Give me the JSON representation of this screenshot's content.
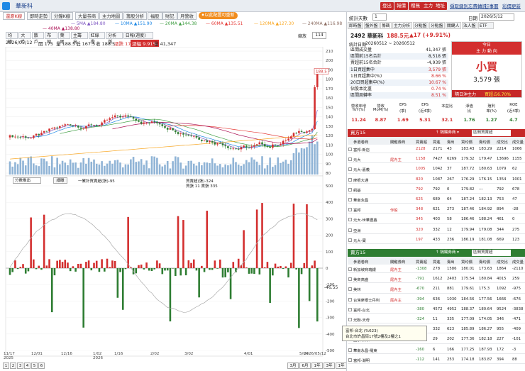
{
  "window": {
    "title": "華新科"
  },
  "top_buttons": [
    "登出",
    "報價",
    "贈無",
    "主力",
    "地址"
  ],
  "top_links": [
    "擷取鍵別",
    "忘費轉訊",
    "行事曆",
    "彩價更新"
  ],
  "tabs": [
    "還原K線",
    "即時走勢",
    "分鐘K線",
    "大量劵商",
    "主力地圖",
    "籌股分析",
    "福股",
    "財記",
    "月營收"
  ],
  "tab_chip": "⚫以此配置可重新",
  "ma_legend": [
    {
      "label": "5MA ▲184.80",
      "color": "#7e57c2"
    },
    {
      "label": "10MA ▲151.90",
      "color": "#1e88e5"
    },
    {
      "label": "20MA ▲144.38",
      "color": "#43a047"
    },
    {
      "label": "60MA ▲135.51",
      "color": "#e53935"
    },
    {
      "label": "120MA ▲127.30",
      "color": "#f9a825"
    },
    {
      "label": "240MA ▲116.98",
      "color": "#8d6e63"
    }
  ],
  "ma_legend2": "40MA ▲138.80",
  "toolbar": [
    "均線",
    "大戶",
    "散戶",
    "布林",
    "葉尾",
    "主籌出",
    "紅綠燈",
    "分析版",
    "日報(週度)"
  ],
  "price_info": {
    "date": "2026/05/12",
    "open": "開 175",
    "high": "量 188.5",
    "low": "低 167.5",
    "close": "收 188.5",
    "chg": "漲跌 17",
    "pct": "漲幅 9.91%",
    "vol": "量 41,347"
  },
  "zoom": "114",
  "zoom_btn": "縮放",
  "price_tag": "188.5",
  "price_axis": [
    "210",
    "200",
    "190",
    "180",
    "170",
    "160",
    "150",
    "140",
    "130",
    "120",
    "110",
    "100",
    "90",
    "80"
  ],
  "lower_axis": [
    "500",
    "400",
    "300",
    "200",
    "100",
    "0",
    "-100",
    "-200",
    "-300",
    "-400",
    "-500"
  ],
  "lower_tag": "-46.55",
  "lower_controls": {
    "select": "分數推出",
    "button": "細瞰",
    "legend1": "一累計買賣超(張)-95",
    "legend2": "買賣超(張)-324",
    "legend3": "買張 11 賣張 335"
  },
  "x_labels": [
    {
      "t": "11/17\n2025"
    },
    {
      "t": "12/01"
    },
    {
      "t": "12/16"
    },
    {
      "t": "1/02\n2026"
    },
    {
      "t": "1/16"
    },
    {
      "t": "2/02"
    },
    {
      "t": "3/02"
    },
    {
      "t": "4/01"
    },
    {
      "t": "5/04"
    },
    {
      "t": "2026/05/12"
    }
  ],
  "pager": [
    "1",
    "2",
    "3",
    "4",
    "5",
    "6"
  ],
  "period_btns": [
    "3月",
    "6月",
    "1年",
    "3年",
    "1年"
  ],
  "right": {
    "period_label": "統計天數",
    "period_value": "1",
    "date_label": "日期",
    "date_value": "2026/5/12",
    "nav_tabs": [
      "即時盤",
      "盤外盤",
      "籌碼",
      "主力分析",
      "分點盤",
      "分點盤",
      "關鍵人",
      "法人盤",
      "ETF"
    ],
    "stock": "2492 華新科",
    "price": "188.5元",
    "change": "▲17 (+9.91%)",
    "stat_label": "統計日期",
    "stat_range": "20260512 ~ 20260512",
    "today": "今日",
    "today_sub": "主 力 動 向",
    "stats": [
      {
        "k": "區間成交量",
        "v": "41,347 張"
      },
      {
        "k": "區間前15名合計",
        "v": "8,518 張"
      },
      {
        "k": "賣超前15名合計",
        "v": "-4,939 張"
      },
      {
        "k": "1日買超集中",
        "v": "3,579 張"
      },
      {
        "k": "1日買超集中(%)",
        "v": "8.66 %"
      },
      {
        "k": "20日買超集中(%)",
        "v": "10.67 %"
      },
      {
        "k": "佔股本比重",
        "v": "0.74 %"
      },
      {
        "k": "區間周轉率",
        "v": "8.51 %"
      }
    ],
    "big_label": "小買",
    "big_value": "3,579 張",
    "footer_l": "隔日沖主力",
    "footer_r": "買超占6.70%",
    "metrics_hdr": [
      "營收年增\nYoY(%)",
      "營收\nMoM(%)",
      "EPS\n(季)",
      "EPS\n(近4季)",
      "本益比",
      "淨值\n比",
      "殖利\n率(%)",
      "ROE\n(近4季)"
    ],
    "metrics": [
      "11.24",
      "8.87",
      "1.69",
      "5.31",
      "32.1",
      "1.76",
      "1.27",
      "4.7"
    ],
    "buy_title": "買方15",
    "sell_title": "賣方15",
    "buy_subtitle": "↑ 隔鍵券商 ▾",
    "buy_dropdown": "區間買賣超",
    "cols": [
      "參選卷商",
      "關鍵券商",
      "買賣超",
      "買進",
      "賣出",
      "買均價",
      "賣均價",
      "成交比",
      "成交量"
    ],
    "buy_rows": [
      [
        "富邦-新店",
        "",
        "2128",
        "2171",
        "43",
        "183.43",
        "183.29",
        "2214",
        "1066"
      ],
      [
        "元大",
        "尾內主",
        "1158",
        "7427",
        "6269",
        "179.32",
        "179.47",
        "13696",
        "1155"
      ],
      [
        "元大-嘉義",
        "",
        "1005",
        "1042",
        "37",
        "187.72",
        "180.63",
        "1079",
        "62"
      ],
      [
        "摩根大通",
        "",
        "820",
        "1087",
        "267",
        "176.29",
        "176.15",
        "1354",
        "1001"
      ],
      [
        "凱基",
        "",
        "792",
        "792",
        "0",
        "179.82",
        "---",
        "792",
        "678"
      ],
      [
        "華南永昌",
        "",
        "625",
        "689",
        "64",
        "187.24",
        "182.13",
        "753",
        "47"
      ],
      [
        "富邦",
        "作股",
        "348",
        "621",
        "273",
        "187.46",
        "184.92",
        "894",
        "-28"
      ],
      [
        "元大-世華農鑫",
        "",
        "345",
        "403",
        "58",
        "186.46",
        "188.24",
        "461",
        "0"
      ],
      [
        "亞洲",
        "",
        "320",
        "332",
        "12",
        "179.94",
        "179.08",
        "344",
        "275"
      ],
      [
        "元大-寶",
        "",
        "197",
        "433",
        "236",
        "186.19",
        "181.08",
        "669",
        "123"
      ]
    ],
    "sell_rows": [
      [
        "新加坡商瑞銀",
        "尾內主",
        "-1308",
        "278",
        "1586",
        "180.01",
        "173.63",
        "1864",
        "-2110"
      ],
      [
        "美商高盛",
        "尾內主",
        "-791",
        "1612",
        "2403",
        "175.54",
        "180.84",
        "4015",
        "259"
      ],
      [
        "美林",
        "尾內主",
        "-670",
        "211",
        "881",
        "179.61",
        "175.3",
        "1092",
        "-975"
      ],
      [
        "台灣摩根士丹利",
        "尾內主",
        "-394",
        "636",
        "1030",
        "184.56",
        "177.56",
        "1666",
        "-676"
      ],
      [
        "富邦-台北",
        "",
        "-380",
        "4572",
        "4952",
        "188.37",
        "180.64",
        "9524",
        "-3838"
      ],
      [
        "光聯-天母",
        "",
        "-324",
        "11",
        "335",
        "177.09",
        "174.05",
        "346",
        "-471"
      ],
      [
        "凱基",
        "",
        "-291",
        "332",
        "623",
        "185.89",
        "186.27",
        "955",
        "-409"
      ],
      [
        "國票-安和",
        "",
        "-200",
        "29",
        "202",
        "177.36",
        "182.18",
        "227",
        "-101"
      ],
      [
        "華南永昌-羅東",
        "",
        "-160",
        "6",
        "166",
        "177.25",
        "187.93",
        "172",
        "-3"
      ],
      [
        "富邦-潮明",
        "",
        "-112",
        "141",
        "253",
        "174.18",
        "183.87",
        "394",
        "88"
      ]
    ],
    "tooltip_line1": "富邦-台北 (%623)",
    "tooltip_line2": "台北市許昌街17號2樓及2樓之1"
  }
}
